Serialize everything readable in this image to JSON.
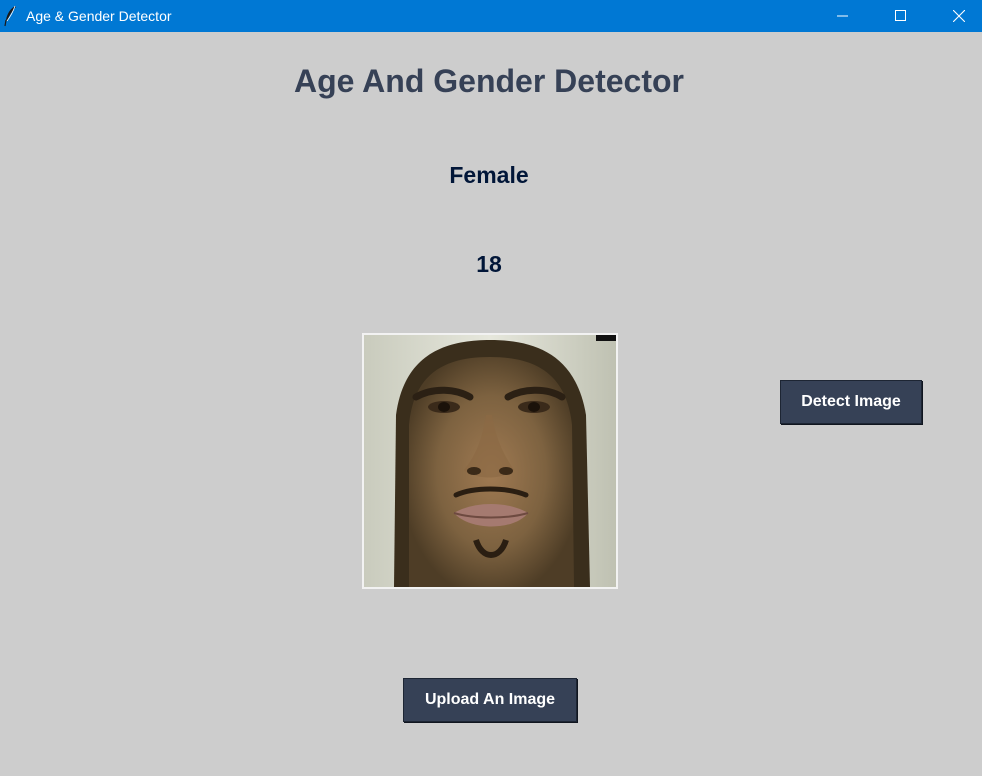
{
  "window": {
    "title": "Age & Gender Detector",
    "titlebar_color": "#0078d4",
    "background_color": "#cdcdcd",
    "controls": [
      "minimize-icon",
      "maximize-icon",
      "close-icon"
    ]
  },
  "main": {
    "heading": "Age And Gender Detector",
    "gender_label": "Female",
    "age_label": "18",
    "uploaded_image": "face photo of a person wearing a light grey hood",
    "heading_color": "#364156",
    "result_color": "#011638"
  },
  "buttons": {
    "detect_label": "Detect Image",
    "upload_label": "Upload An Image",
    "color": "#364156"
  }
}
